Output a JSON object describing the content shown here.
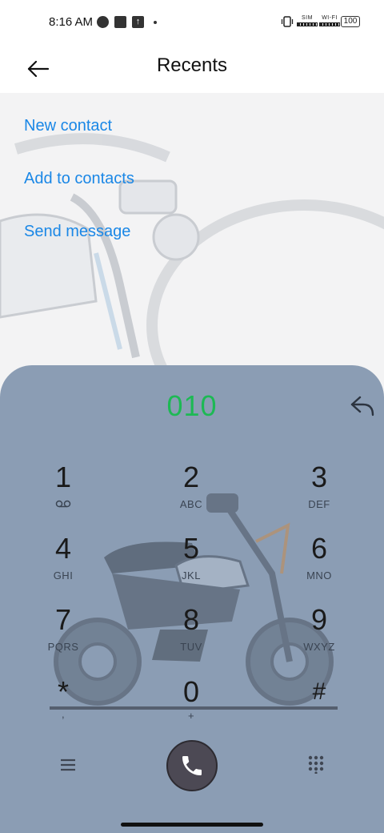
{
  "status_bar": {
    "time": "8:16 AM",
    "sim_label": "SIM",
    "wifi_label": "WI-FI",
    "battery": "100"
  },
  "header": {
    "title": "Recents",
    "back_icon": "arrow-left-icon"
  },
  "actions": {
    "new_contact": "New contact",
    "add_to_contacts": "Add to contacts",
    "send_message": "Send message"
  },
  "dialer": {
    "number": "010",
    "keys": [
      {
        "digit": "1",
        "letters": ""
      },
      {
        "digit": "2",
        "letters": "ABC"
      },
      {
        "digit": "3",
        "letters": "DEF"
      },
      {
        "digit": "4",
        "letters": "GHI"
      },
      {
        "digit": "5",
        "letters": "JKL"
      },
      {
        "digit": "6",
        "letters": "MNO"
      },
      {
        "digit": "7",
        "letters": "PQRS"
      },
      {
        "digit": "8",
        "letters": "TUV"
      },
      {
        "digit": "9",
        "letters": "WXYZ"
      },
      {
        "digit": "*",
        "letters": ","
      },
      {
        "digit": "0",
        "letters": "+"
      },
      {
        "digit": "#",
        "letters": ""
      }
    ]
  },
  "colors": {
    "accent": "#1a87e6",
    "number": "#1db954",
    "dialer_bg": "#8b9db4",
    "call_button": "#4c4954"
  }
}
